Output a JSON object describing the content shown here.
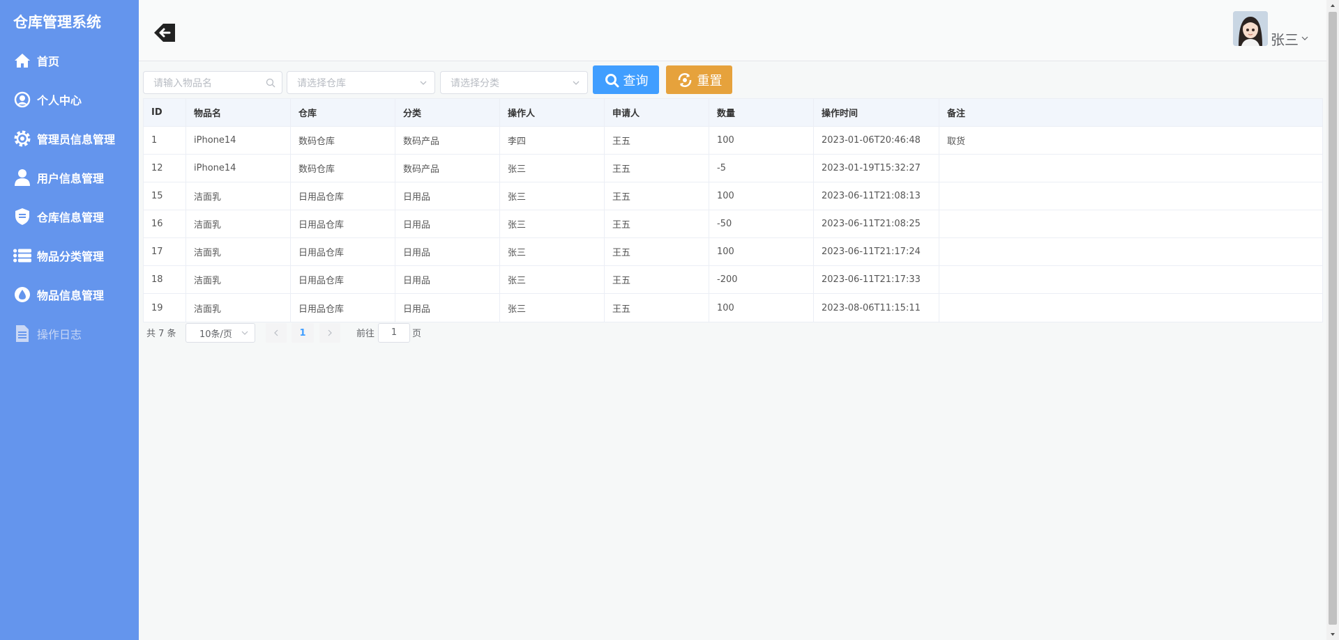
{
  "sidebar": {
    "brand": "仓库管理系统",
    "items": [
      {
        "label": "首页",
        "icon": "home-icon"
      },
      {
        "label": "个人中心",
        "icon": "user-circle-icon"
      },
      {
        "label": "管理员信息管理",
        "icon": "gear-icon"
      },
      {
        "label": "用户信息管理",
        "icon": "person-icon"
      },
      {
        "label": "仓库信息管理",
        "icon": "shield-icon"
      },
      {
        "label": "物品分类管理",
        "icon": "list-icon"
      },
      {
        "label": "物品信息管理",
        "icon": "drop-icon"
      },
      {
        "label": "操作日志",
        "icon": "document-icon"
      }
    ]
  },
  "header": {
    "user_name": "张三"
  },
  "filters": {
    "item_name_placeholder": "请输入物品名",
    "warehouse_placeholder": "请选择仓库",
    "category_placeholder": "请选择分类",
    "query_label": "查询",
    "reset_label": "重置"
  },
  "table": {
    "headers": [
      "ID",
      "物品名",
      "仓库",
      "分类",
      "操作人",
      "申请人",
      "数量",
      "操作时间",
      "备注"
    ],
    "rows": [
      [
        "1",
        "iPhone14",
        "数码仓库",
        "数码产品",
        "李四",
        "王五",
        "100",
        "2023-01-06T20:46:48",
        "取货"
      ],
      [
        "12",
        "iPhone14",
        "数码仓库",
        "数码产品",
        "张三",
        "王五",
        "-5",
        "2023-01-19T15:32:27",
        ""
      ],
      [
        "15",
        "洁面乳",
        "日用品仓库",
        "日用品",
        "张三",
        "王五",
        "100",
        "2023-06-11T21:08:13",
        ""
      ],
      [
        "16",
        "洁面乳",
        "日用品仓库",
        "日用品",
        "张三",
        "王五",
        "-50",
        "2023-06-11T21:08:25",
        ""
      ],
      [
        "17",
        "洁面乳",
        "日用品仓库",
        "日用品",
        "张三",
        "王五",
        "100",
        "2023-06-11T21:17:24",
        ""
      ],
      [
        "18",
        "洁面乳",
        "日用品仓库",
        "日用品",
        "张三",
        "王五",
        "-200",
        "2023-06-11T21:17:33",
        ""
      ],
      [
        "19",
        "洁面乳",
        "日用品仓库",
        "日用品",
        "张三",
        "王五",
        "100",
        "2023-08-06T11:15:11",
        ""
      ]
    ]
  },
  "pagination": {
    "total_text": "共 7 条",
    "page_size": "10条/页",
    "current_page": "1",
    "goto_label": "前往",
    "goto_value": "1",
    "page_unit": "页"
  },
  "colors": {
    "sidebar_bg": "#6495ED",
    "query_button": "#409eff",
    "reset_button": "#e6a23c"
  }
}
